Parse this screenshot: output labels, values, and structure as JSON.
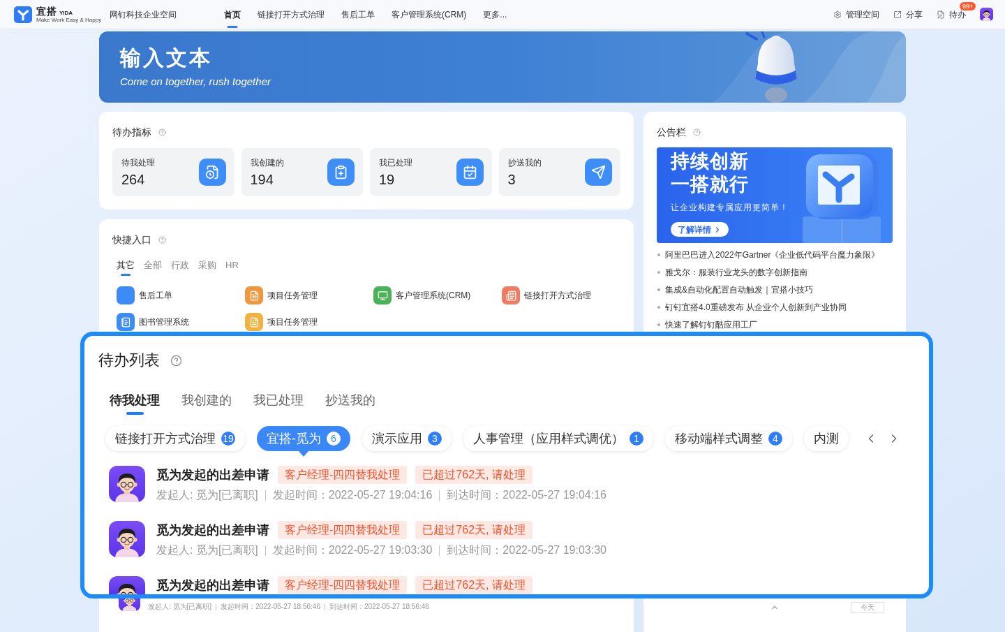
{
  "topbar": {
    "logo": {
      "name": "宜搭",
      "latin": "YIDA",
      "tagline": "Make Work Easy & Happy"
    },
    "workspace": "网钉科技企业空间",
    "nav": [
      {
        "label": "首页",
        "selected": true
      },
      {
        "label": "链接打开方式治理",
        "selected": false
      },
      {
        "label": "售后工单",
        "selected": false
      },
      {
        "label": "客户管理系统(CRM)",
        "selected": false
      },
      {
        "label": "更多...",
        "selected": false
      }
    ],
    "actions": [
      {
        "kind": "settings",
        "label": "管理空间"
      },
      {
        "kind": "share",
        "label": "分享"
      },
      {
        "kind": "todo",
        "label": "待办",
        "badge": "99+"
      }
    ]
  },
  "banner": {
    "title": "输入文本",
    "subtitle": "Come on together, rush together"
  },
  "todo_metrics": {
    "title": "待办指标",
    "items": [
      {
        "kind": "pending",
        "label": "待我处理",
        "value": "264"
      },
      {
        "kind": "created",
        "label": "我创建的",
        "value": "194"
      },
      {
        "kind": "done",
        "label": "我已处理",
        "value": "19"
      },
      {
        "kind": "cc",
        "label": "抄送我的",
        "value": "3"
      }
    ]
  },
  "notice_board": {
    "title": "公告栏",
    "promo": {
      "headline": [
        "持续创新",
        "一搭就行"
      ],
      "text": "让企业构建专属应用更简单！",
      "button": "了解详情"
    },
    "items": [
      "阿里巴巴进入2022年Gartner《企业低代码平台魔力象限》",
      "雅戈尔：服装行业龙头的数字创新指南",
      "集成&自动化配置自动触发｜宜搭小技巧",
      "钉钉宜搭4.0重磅发布 从企业个人创新到产业协同",
      "快速了解钉钉酷应用工厂"
    ]
  },
  "quick_entry": {
    "title": "快捷入口",
    "tabs": [
      {
        "label": "其它",
        "selected": true
      },
      {
        "label": "全部",
        "selected": false
      },
      {
        "label": "行政",
        "selected": false
      },
      {
        "label": "采购",
        "selected": false
      },
      {
        "label": "HR",
        "selected": false
      }
    ],
    "apps": [
      {
        "label": "售后工单",
        "kind": "blank",
        "color": "#3d8bf7"
      },
      {
        "label": "项目任务管理",
        "kind": "document",
        "color": "#f0963b"
      },
      {
        "label": "客户管理系统(CRM)",
        "kind": "monitor",
        "color": "#4cb257"
      },
      {
        "label": "链接打开方式治理",
        "kind": "newspaper",
        "color": "#ef7b63"
      },
      {
        "label": "图书管理系统",
        "kind": "list",
        "color": "#3d8bf7"
      },
      {
        "label": "项目任务管理",
        "kind": "document",
        "color": "#f3b23f"
      }
    ]
  },
  "todo_list": {
    "title": "待办列表",
    "tabs": [
      {
        "label": "待我处理",
        "selected": true
      },
      {
        "label": "我创建的",
        "selected": false
      },
      {
        "label": "我已处理",
        "selected": false
      },
      {
        "label": "抄送我的",
        "selected": false
      }
    ],
    "categories": [
      {
        "label": "链接打开方式治理",
        "count": "19",
        "selected": false
      },
      {
        "label": "宜搭-觅为",
        "count": "6",
        "selected": true
      },
      {
        "label": "演示应用",
        "count": "3",
        "selected": false
      },
      {
        "label": "人事管理（应用样式调优）",
        "count": "1",
        "selected": false
      },
      {
        "label": "移动端样式调整",
        "count": "4",
        "selected": false
      },
      {
        "label": "内测",
        "selected": false
      }
    ],
    "rows": [
      {
        "title": "觅为发起的出差申请",
        "tags": [
          "客户经理-四四替我处理",
          "已超过762天, 请处理"
        ],
        "meta": [
          "发起人: 觅为[已离职]",
          "发起时间：2022-05-27 19:04:16",
          "到达时间：2022-05-27 19:04:16"
        ]
      },
      {
        "title": "觅为发起的出差申请",
        "tags": [
          "客户经理-四四替我处理",
          "已超过762天, 请处理"
        ],
        "meta": [
          "发起人: 觅为[已离职]",
          "发起时间：2022-05-27 19:03:30",
          "到达时间：2022-05-27 19:03:30"
        ]
      },
      {
        "title": "觅为发起的出差申请",
        "tags": [
          "客户经理-四四替我处理",
          "已超过762天, 请处理"
        ]
      }
    ]
  },
  "todo_card_behind": {
    "rows": [
      {
        "meta": [
          "发起人: 觅为[已离职]",
          "发起时间：2022-05-27 18:56:46",
          "到达时间：2022-05-27 18:56:46"
        ]
      }
    ]
  },
  "calendar_card_behind": {
    "today_button": "今天"
  }
}
